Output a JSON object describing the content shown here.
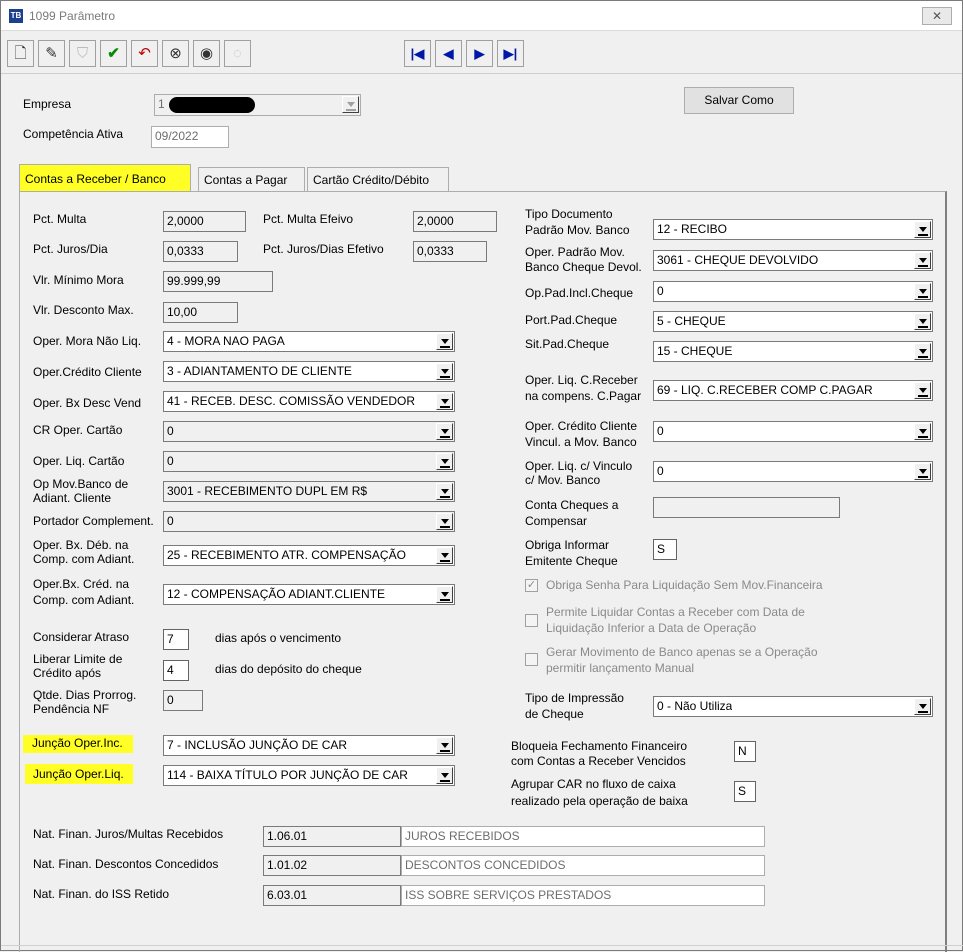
{
  "window": {
    "title": "1099 Parâmetro",
    "icon": "app-icon",
    "close": "✕"
  },
  "toolbar": {
    "icons": [
      "new-document-icon",
      "edit-icon",
      "shield-icon",
      "checkmark-icon",
      "undo-icon",
      "binoculars-icon",
      "disk-icon",
      "cd-icon"
    ],
    "nav": [
      "first-record-icon",
      "previous-record-icon",
      "next-record-icon",
      "last-record-icon"
    ]
  },
  "header": {
    "empresa_label": "Empresa",
    "empresa_value": "1",
    "competencia_label": "Competência Ativa",
    "competencia_value": "09/2022",
    "salvar_como": "Salvar Como"
  },
  "tabs": [
    "Contas a Receber / Banco",
    "Contas a Pagar",
    "Cartão Crédito/Débito"
  ],
  "left": {
    "pct_multa": {
      "label": "Pct. Multa",
      "value": "2,0000"
    },
    "pct_multa_efetivo": {
      "label": "Pct. Multa Efeivo",
      "value": "2,0000"
    },
    "pct_juros_dia": {
      "label": "Pct. Juros/Dia",
      "value": "0,0333"
    },
    "pct_juros_efetivo": {
      "label": "Pct. Juros/Dias Efetivo",
      "value": "0,0333"
    },
    "vlr_min_mora": {
      "label": "Vlr. Mínimo Mora",
      "value": "99.999,99"
    },
    "vlr_desc_max": {
      "label": "Vlr. Desconto Max.",
      "value": "10,00"
    },
    "oper_mora": {
      "label": "Oper. Mora Não Liq.",
      "value": "4 - MORA NAO PAGA"
    },
    "oper_credito": {
      "label": "Oper.Crédito Cliente",
      "value": "3 - ADIANTAMENTO DE CLIENTE"
    },
    "oper_bx_desc": {
      "label": "Oper. Bx Desc Vend",
      "value": "41 - RECEB. DESC. COMISSÃO VENDEDOR"
    },
    "cr_oper_cartao": {
      "label": "CR Oper. Cartão",
      "value": "0"
    },
    "oper_liq_cartao": {
      "label": "Oper. Liq. Cartão",
      "value": "0"
    },
    "op_mov_banco": {
      "label1": "Op Mov.Banco de",
      "label2": "Adiant. Cliente",
      "value": "3001 - RECEBIMENTO DUPL EM R$"
    },
    "portador": {
      "label": "Portador Complement.",
      "value": "0"
    },
    "oper_bx_deb": {
      "label1": "Oper. Bx. Déb. na",
      "label2": "Comp. com Adiant.",
      "value": "25 - RECEBIMENTO ATR. COMPENSAÇÃO"
    },
    "oper_bx_cred": {
      "label1": "Oper.Bx. Créd. na",
      "label2": "Comp. com Adiant.",
      "value": "12 - COMPENSAÇÃO ADIANT.CLIENTE"
    },
    "considerar_atraso": {
      "label": "Considerar Atraso",
      "value": "7",
      "suffix": "dias após o vencimento"
    },
    "liberar_limite": {
      "label1": "Liberar Limite de",
      "label2": "Crédito após",
      "value": "4",
      "suffix": "dias do depósito do cheque"
    },
    "qtde_dias": {
      "label1": "Qtde. Dias Prorrog.",
      "label2": "Pendência NF",
      "value": "0"
    },
    "juncao_inc": {
      "label": "Junção Oper.Inc.",
      "value": "7 - INCLUSÃO JUNÇÃO DE CAR"
    },
    "juncao_liq": {
      "label": "Junção Oper.Liq.",
      "value": "114 - BAIXA TÍTULO POR JUNÇÃO DE CAR"
    }
  },
  "right": {
    "tipo_doc": {
      "label1": "Tipo Documento",
      "label2": "Padrão Mov. Banco",
      "value": "12 - RECIBO"
    },
    "oper_padrao": {
      "label1": "Oper. Padrão Mov.",
      "label2": "Banco Cheque Devol.",
      "value": "3061 - CHEQUE DEVOLVIDO"
    },
    "op_pad_incl": {
      "label": "Op.Pad.Incl.Cheque",
      "value": "0"
    },
    "port_pad": {
      "label": "Port.Pad.Cheque",
      "value": "5 - CHEQUE"
    },
    "sit_pad": {
      "label": "Sit.Pad.Cheque",
      "value": "15 - CHEQUE"
    },
    "oper_liq_creceber": {
      "label1": "Oper. Liq. C.Receber",
      "label2": "na compens. C.Pagar",
      "value": "69 - LIQ. C.RECEBER COMP C.PAGAR"
    },
    "oper_credito_vincul": {
      "label1": "Oper. Crédito Cliente",
      "label2": "Vincul. a Mov. Banco",
      "value": "0"
    },
    "oper_liq_vinculo": {
      "label1": "Oper. Liq. c/ Vinculo",
      "label2": "c/ Mov. Banco",
      "value": "0"
    },
    "conta_cheques": {
      "label1": "Conta Cheques a",
      "label2": "Compensar",
      "value": ""
    },
    "obriga_informar": {
      "label1": "Obriga Informar",
      "label2": "Emitente Cheque",
      "value": "S"
    },
    "chk1": {
      "label": "Obriga Senha Para Liquidação Sem Mov.Financeira",
      "checked": "✓"
    },
    "chk2": {
      "label1": "Permite Liquidar Contas a Receber com Data de",
      "label2": "Liquidação Inferior a Data de Operação"
    },
    "chk3": {
      "label1": "Gerar Movimento de Banco apenas se a Operação",
      "label2": "permitir lançamento Manual"
    },
    "tipo_impressao": {
      "label1": "Tipo de Impressão",
      "label2": "de Cheque",
      "value": "0 - Não Utiliza"
    },
    "bloqueia": {
      "label1": "Bloqueia Fechamento Financeiro",
      "label2": "com Contas a Receber Vencidos",
      "value": "N"
    },
    "agrupar": {
      "label1": "Agrupar CAR no fluxo de caixa",
      "label2": "realizado pela operação de baixa",
      "value": "S"
    }
  },
  "bottom": {
    "nat_juros": {
      "label": "Nat. Finan. Juros/Multas Recebidos",
      "code": "1.06.01",
      "desc": "JUROS RECEBIDOS"
    },
    "nat_descontos": {
      "label": "Nat. Finan. Descontos Concedidos",
      "code": "1.01.02",
      "desc": "DESCONTOS CONCEDIDOS"
    },
    "nat_iss": {
      "label": "Nat. Finan. do ISS Retido",
      "code": "6.03.01",
      "desc": "ISS SOBRE SERVIÇOS PRESTADOS"
    }
  },
  "colors": {
    "highlight": "#ffff26",
    "nav": "#0018a8"
  }
}
